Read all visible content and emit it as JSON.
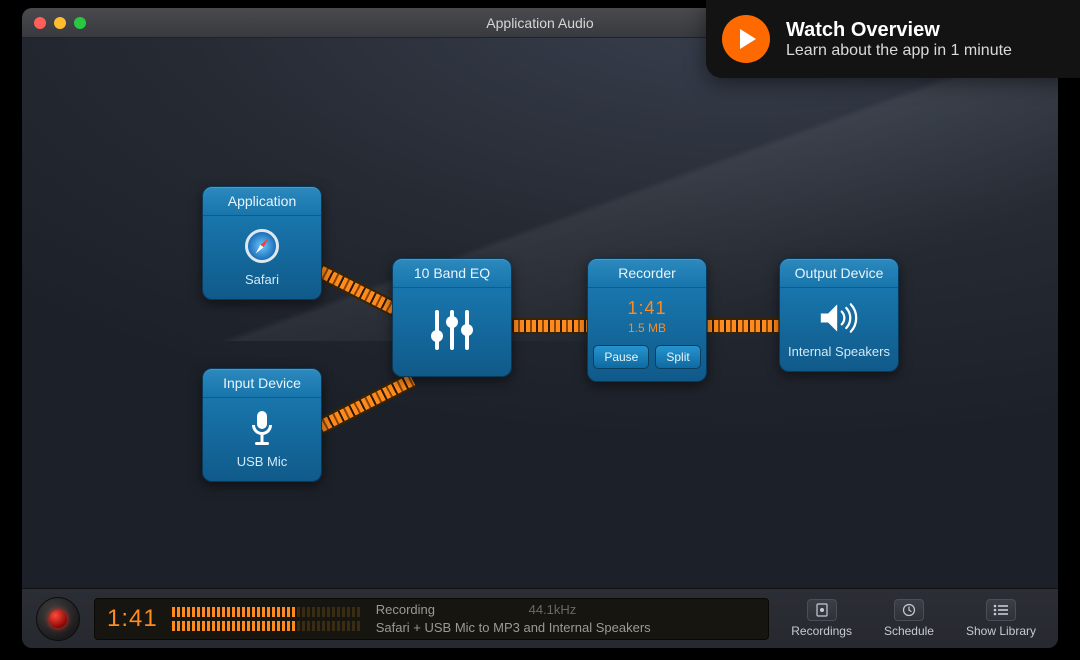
{
  "window": {
    "title": "Application Audio"
  },
  "overview": {
    "heading": "Watch Overview",
    "subtitle": "Learn about the app in 1 minute"
  },
  "nodes": {
    "application": {
      "title": "Application",
      "label": "Safari"
    },
    "input": {
      "title": "Input Device",
      "label": "USB Mic"
    },
    "eq": {
      "title": "10 Band EQ"
    },
    "recorder": {
      "title": "Recorder",
      "time": "1:41",
      "size": "1.5 MB",
      "pause": "Pause",
      "split": "Split"
    },
    "output": {
      "title": "Output Device",
      "label": "Internal Speakers"
    }
  },
  "footer": {
    "time": "1:41",
    "status": "Recording",
    "sample_rate": "44.1kHz",
    "detail": "Safari + USB Mic to MP3 and Internal Speakers",
    "buttons": {
      "recordings": "Recordings",
      "schedule": "Schedule",
      "library": "Show Library"
    }
  }
}
